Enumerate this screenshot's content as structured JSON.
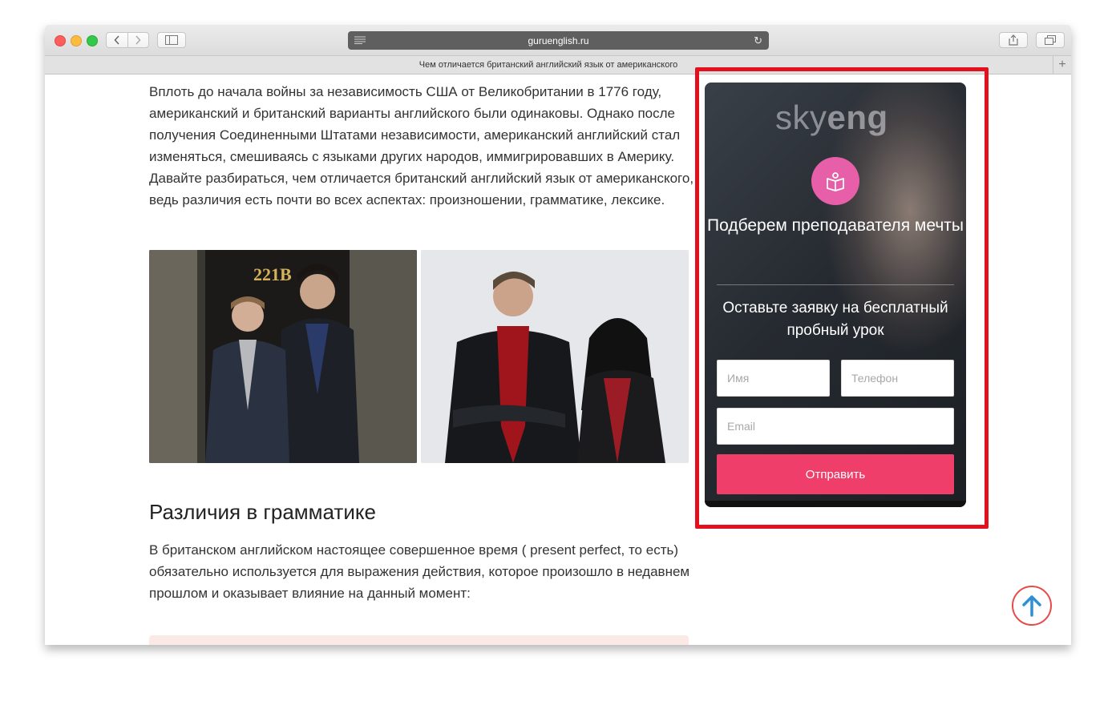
{
  "browser": {
    "url": "guruenglish.ru",
    "tab_title": "Чем отличается британский английский язык от американского",
    "tab_add": "+"
  },
  "article": {
    "intro": "Вплоть до начала войны за независимость США от Великобритании в 1776 году, американский и британский варианты английского были одинаковы. Однако после получения Соединенными Штатами независимости, американский английский стал изменяться, смешиваясь с языками других народов, иммигрировавших в Америку. Давайте разбираться, чем отличается британский английский язык от американского, ведь различия есть почти во всех аспектах: произношении, грамматике, лексике.",
    "photo1_sign": "221B",
    "heading": "Различия в грамматике",
    "paragraph": "В британском английском настоящее совершенное время ( present perfect, то есть) обязательно используется для выражения действия, которое произошло в недавнем прошлом и оказывает влияние на данный момент:"
  },
  "widget": {
    "logo_light": "sky",
    "logo_bold": "eng",
    "title": "Подберем преподавателя мечты",
    "subtitle": "Оставьте заявку на бесплатный пробный урок",
    "name_placeholder": "Имя",
    "phone_placeholder": "Телефон",
    "email_placeholder": "Email",
    "submit_label": "Отправить",
    "accent_color": "#f03e6b",
    "badge_color": "#e65fa8"
  },
  "annotation": {
    "highlight_color": "#e3101d"
  },
  "scroll_top": {
    "icon": "arrow-up-icon",
    "color": "#2f8fd6"
  }
}
